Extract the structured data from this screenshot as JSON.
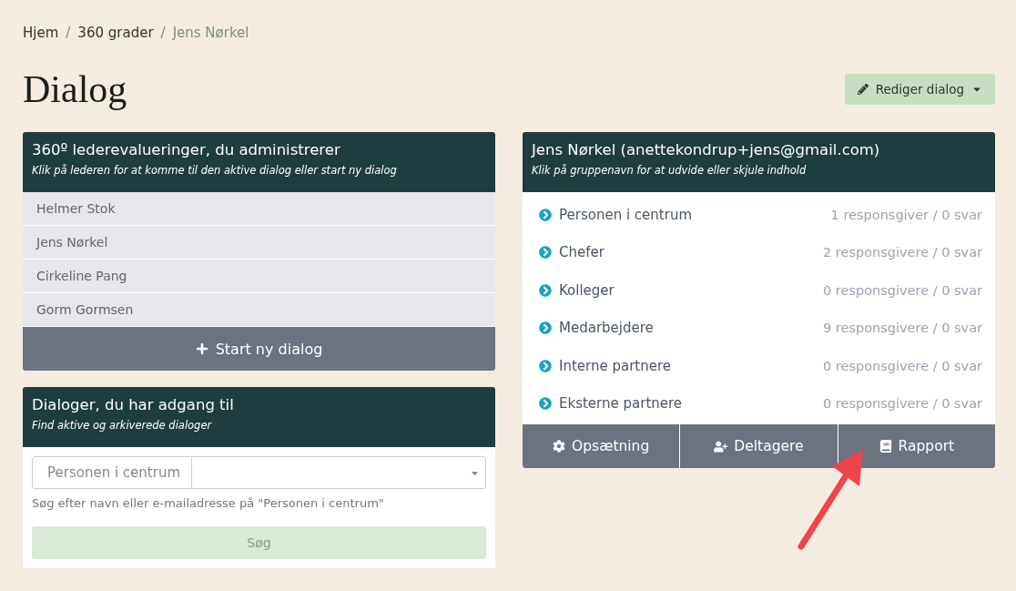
{
  "breadcrumb_separator": "/",
  "breadcrumb": [
    {
      "label": "Hjem",
      "current": false
    },
    {
      "label": "360 grader",
      "current": false
    },
    {
      "label": "Jens Nørkel",
      "current": true
    }
  ],
  "title": "Dialog",
  "edit_button": {
    "label": "Rediger dialog"
  },
  "managed_panel": {
    "title": "360º lederevalueringer, du administrerer",
    "subtitle": "Klik på lederen for at komme til den aktive dialog eller start ny dialog",
    "leaders": [
      "Helmer Stok",
      "Jens Nørkel",
      "Cirkeline Pang",
      "Gorm Gormsen"
    ],
    "start_button": "Start ny dialog"
  },
  "access_panel": {
    "title": "Dialoger, du har adgang til",
    "subtitle": "Find aktive og arkiverede dialoger",
    "prefix": "Personen i centrum",
    "help": "Søg efter navn eller e-mailadresse på \"Personen i centrum\"",
    "search_button": {
      "label": "Søg",
      "disabled": true
    }
  },
  "person_panel": {
    "title": "Jens Nørkel (anettekondrup+jens@gmail.com)",
    "subtitle": "Klik på gruppenavn for at udvide eller skjule indhold",
    "groups": [
      {
        "name": "Personen i centrum",
        "count": "1 responsgiver / 0 svar"
      },
      {
        "name": "Chefer",
        "count": "2 responsgivere / 0 svar"
      },
      {
        "name": "Kolleger",
        "count": "0 responsgivere / 0 svar"
      },
      {
        "name": "Medarbejdere",
        "count": "9 responsgivere / 0 svar"
      },
      {
        "name": "Interne partnere",
        "count": "0 responsgivere / 0 svar"
      },
      {
        "name": "Eksterne partnere",
        "count": "0 responsgivere / 0 svar"
      }
    ],
    "actions": [
      {
        "label": "Opsætning",
        "kind": "settings"
      },
      {
        "label": "Deltagere",
        "kind": "participants"
      },
      {
        "label": "Rapport",
        "kind": "report"
      }
    ]
  },
  "pointer_arrow": true
}
